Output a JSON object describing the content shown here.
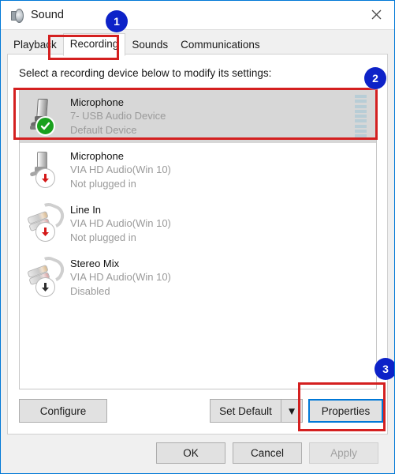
{
  "window": {
    "title": "Sound",
    "title_icon": "speaker-icon",
    "close_icon": "close-icon"
  },
  "tabs": [
    {
      "label": "Playback",
      "selected": false
    },
    {
      "label": "Recording",
      "selected": true
    },
    {
      "label": "Sounds",
      "selected": false
    },
    {
      "label": "Communications",
      "selected": false
    }
  ],
  "page": {
    "hint": "Select a recording device below to modify its settings:"
  },
  "devices": [
    {
      "name": "Microphone",
      "driver": "7- USB Audio Device",
      "status": "Default Device",
      "icon": "usb-microphone-icon",
      "badge": "green-check-badge",
      "selected": true,
      "meter_segments": 9
    },
    {
      "name": "Microphone",
      "driver": "VIA HD Audio(Win 10)",
      "status": "Not plugged in",
      "icon": "jack-microphone-icon",
      "badge": "red-down-arrow-badge",
      "selected": false,
      "meter_segments": 0
    },
    {
      "name": "Line In",
      "driver": "VIA HD Audio(Win 10)",
      "status": "Not plugged in",
      "icon": "line-in-cable-icon",
      "badge": "red-down-arrow-badge",
      "selected": false,
      "meter_segments": 0
    },
    {
      "name": "Stereo Mix",
      "driver": "VIA HD Audio(Win 10)",
      "status": "Disabled",
      "icon": "stereo-mix-cable-icon",
      "badge": "black-down-arrow-badge",
      "selected": false,
      "meter_segments": 0
    }
  ],
  "buttons": {
    "configure": "Configure",
    "set_default": "Set Default",
    "set_default_arrow": "▼",
    "properties": "Properties",
    "ok": "OK",
    "cancel": "Cancel",
    "apply": "Apply"
  },
  "annotations": {
    "badges": [
      "1",
      "2",
      "3"
    ],
    "color": "#0d22c8",
    "box_color": "#d42020"
  },
  "colors": {
    "accent": "#0078d7",
    "selected_row": "#d7d7d7",
    "default_check": "#19a01e",
    "unplugged_arrow": "#d41818",
    "meter": "#b8cdd6"
  }
}
